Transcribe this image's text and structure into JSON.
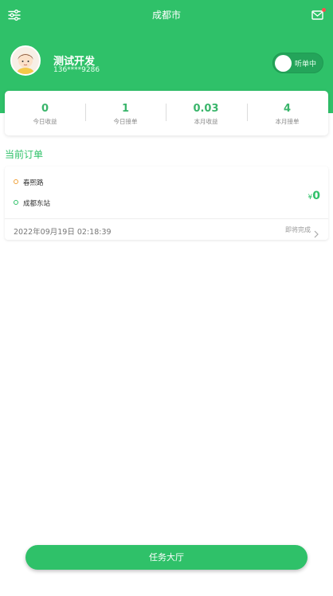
{
  "header": {
    "city": "成都市",
    "user": {
      "name": "测试开发",
      "phone": "136****9286"
    },
    "listen_toggle": {
      "label": "听单中"
    }
  },
  "stats": [
    {
      "value": "0",
      "label": "今日收益"
    },
    {
      "value": "1",
      "label": "今日接单"
    },
    {
      "value": "0.03",
      "label": "本月收益"
    },
    {
      "value": "4",
      "label": "本月接单"
    }
  ],
  "orders": {
    "section_title": "当前订单",
    "current": {
      "from": "春熙路",
      "to": "成都东站",
      "currency": "¥",
      "price": "0",
      "time": "2022年09月19日 02:18:39",
      "status": "即将完成"
    }
  },
  "footer": {
    "button_label": "任务大厅"
  },
  "colors": {
    "primary": "#2fc169",
    "from_dot": "#f0a13a",
    "to_dot": "#2fc169",
    "notification_dot": "#ff4d4f"
  }
}
